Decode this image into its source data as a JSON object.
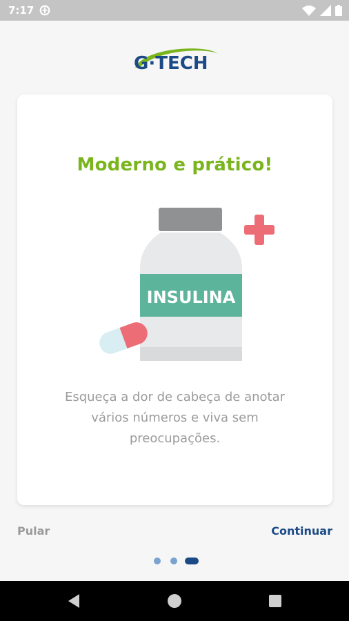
{
  "status_bar": {
    "time": "7:17",
    "icons": [
      "data-saver-icon",
      "wifi-icon",
      "signal-icon",
      "battery-icon"
    ]
  },
  "brand": {
    "logo_text": "G·TECH",
    "colors": {
      "blue": "#1b4a86",
      "green": "#7ab51d"
    }
  },
  "onboarding": {
    "title": "Moderno e prático!",
    "illustration": {
      "bottle_label": "INSULINA",
      "icons": [
        "insulin-bottle-icon",
        "pill-capsule-icon",
        "plus-cross-icon"
      ]
    },
    "description": "Esqueça a dor de cabeça de anotar vários números e viva sem preocupações."
  },
  "actions": {
    "skip_label": "Pular",
    "continue_label": "Continuar"
  },
  "pagination": {
    "total": 3,
    "current": 3
  },
  "nav_bar": {
    "icons": [
      "back-icon",
      "home-icon",
      "recents-icon"
    ]
  }
}
